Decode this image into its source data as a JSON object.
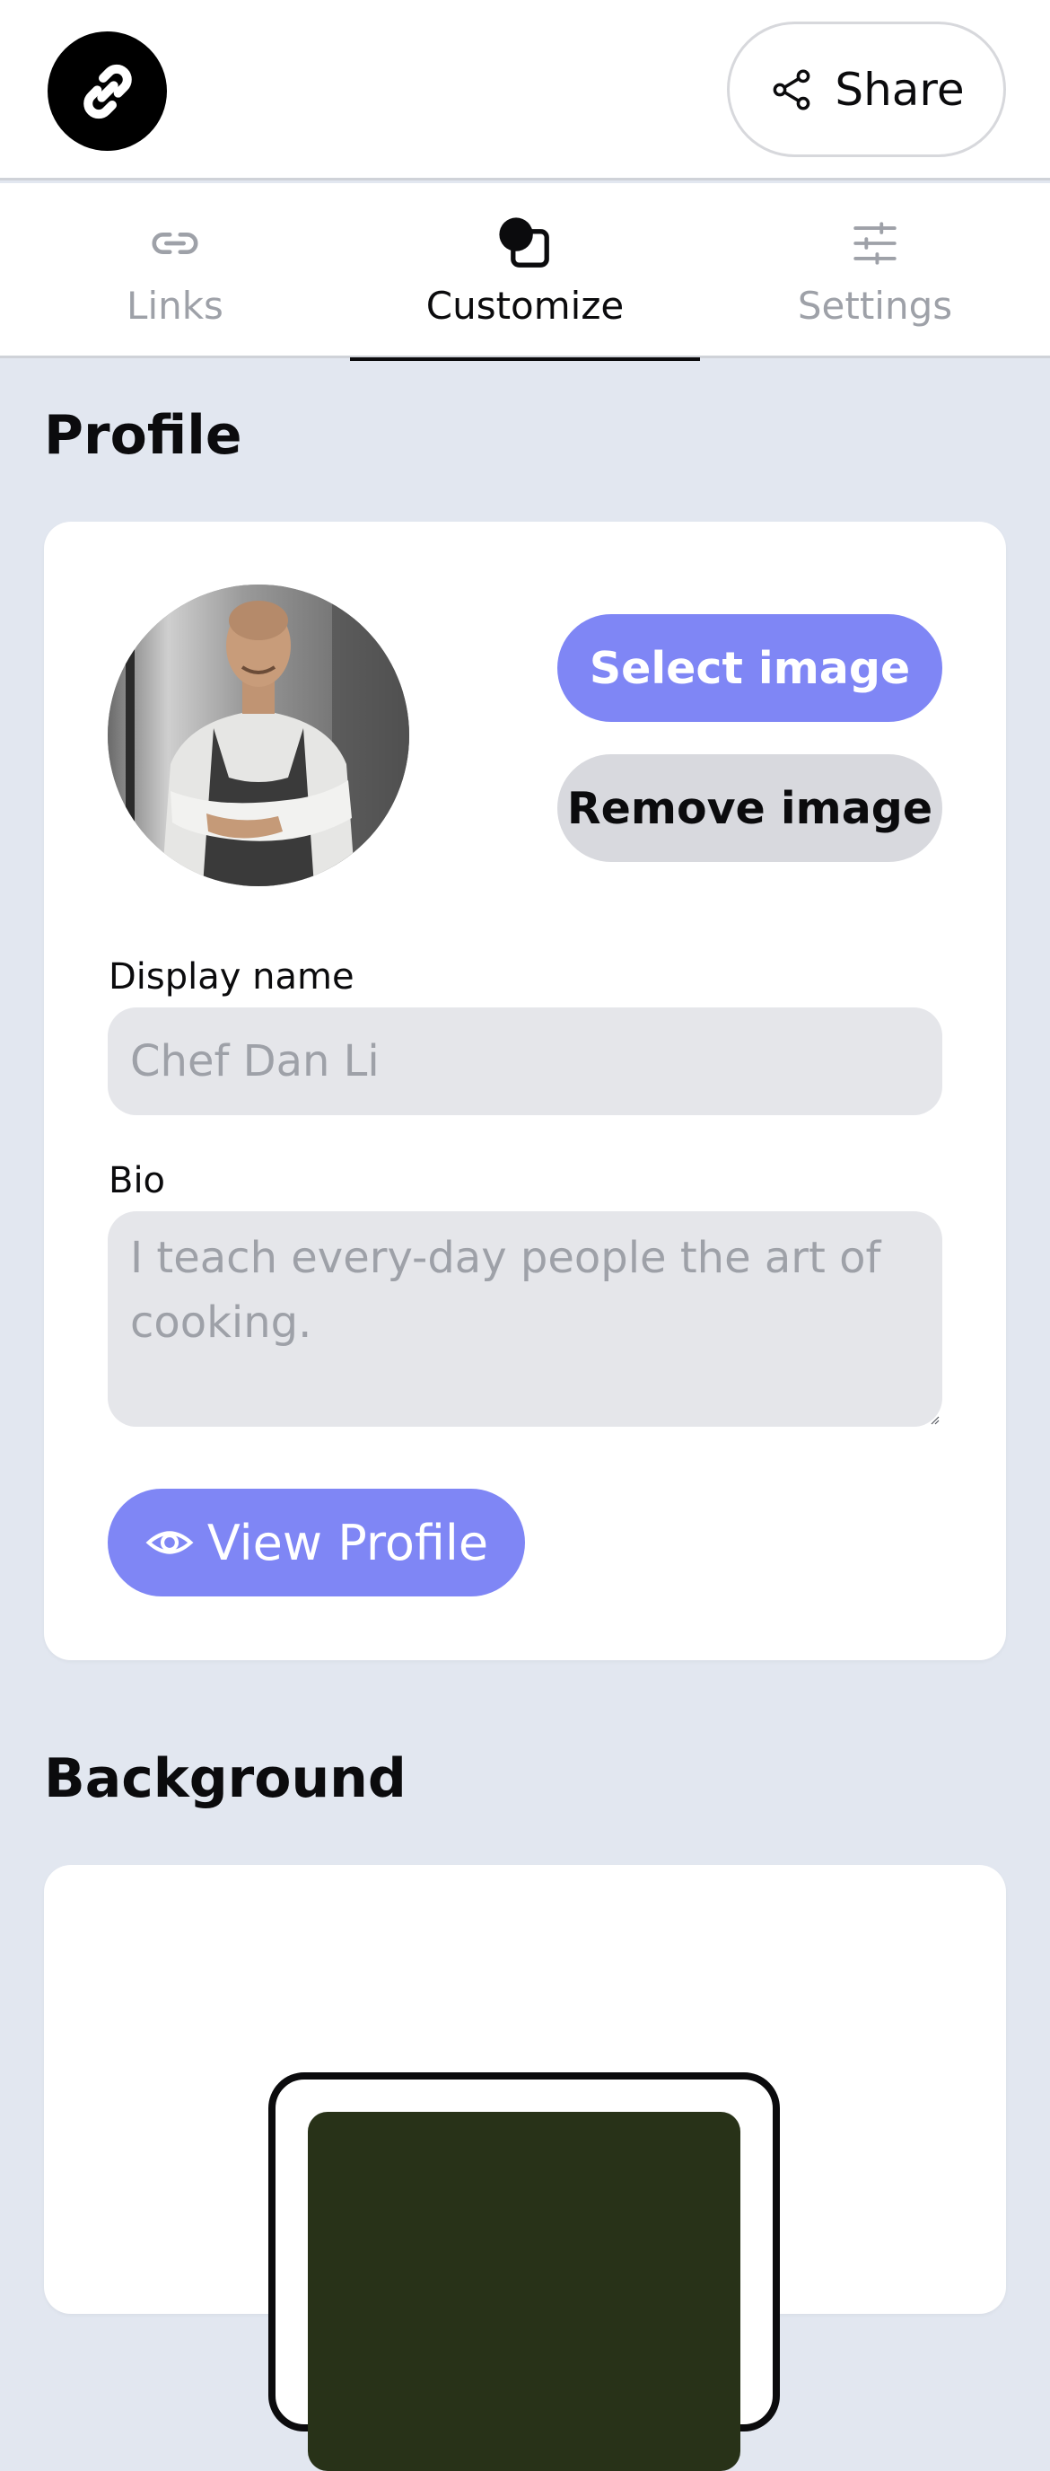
{
  "header": {
    "share_label": "Share"
  },
  "tabs": [
    {
      "label": "Links",
      "icon": "link-icon",
      "active": false
    },
    {
      "label": "Customize",
      "icon": "customize-icon",
      "active": true
    },
    {
      "label": "Settings",
      "icon": "sliders-icon",
      "active": false
    }
  ],
  "profile": {
    "section_title": "Profile",
    "select_image_label": "Select image",
    "remove_image_label": "Remove image",
    "display_name_label": "Display name",
    "display_name_placeholder": "Chef Dan Li",
    "bio_label": "Bio",
    "bio_placeholder": "I teach every-day people the art of cooking.",
    "view_profile_label": "View Profile"
  },
  "background": {
    "section_title": "Background",
    "preview_color": "#283218"
  },
  "colors": {
    "accent": "#7f86f5",
    "page_bg": "#e2e7f0",
    "muted_text": "#9ea1a8"
  }
}
